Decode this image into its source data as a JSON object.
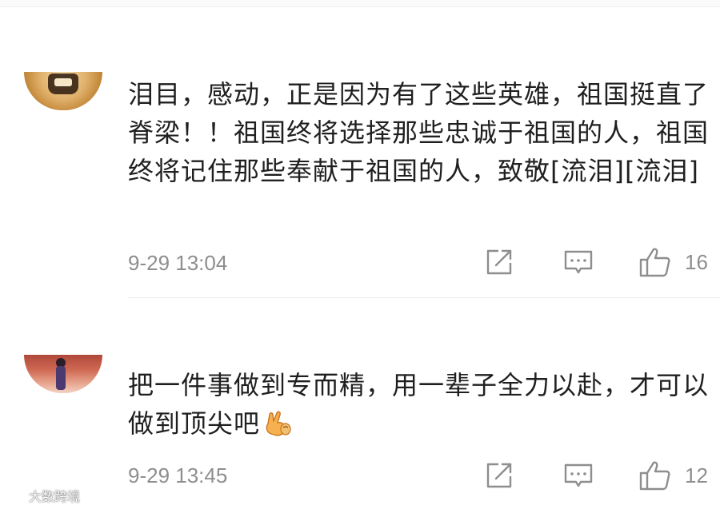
{
  "comments": [
    {
      "text": "泪目，感动，正是因为有了这些英雄，祖国挺直了脊梁！！祖国终将选择那些忠诚于祖国的人，祖国终将记住那些奉献于祖国的人，致敬[流泪][流泪]",
      "time": "9-29 13:04",
      "likes": "16",
      "avatar_icon": "user-avatar-icon"
    },
    {
      "text": "把一件事做到专而精，用一辈子全力以赴，才可以做到顶尖吧",
      "emoji_icon": "victory-hand-emoji-icon",
      "time": "9-29 13:45",
      "likes": "12",
      "avatar_icon": "user-avatar-icon"
    }
  ],
  "icons": {
    "share": "share-icon",
    "reply": "comment-icon",
    "like": "thumbs-up-icon"
  },
  "colors": {
    "text": "#1f1f1f",
    "meta": "#8e8e8e",
    "divider": "#ececec"
  },
  "watermark": {
    "text": "大数跨境"
  }
}
